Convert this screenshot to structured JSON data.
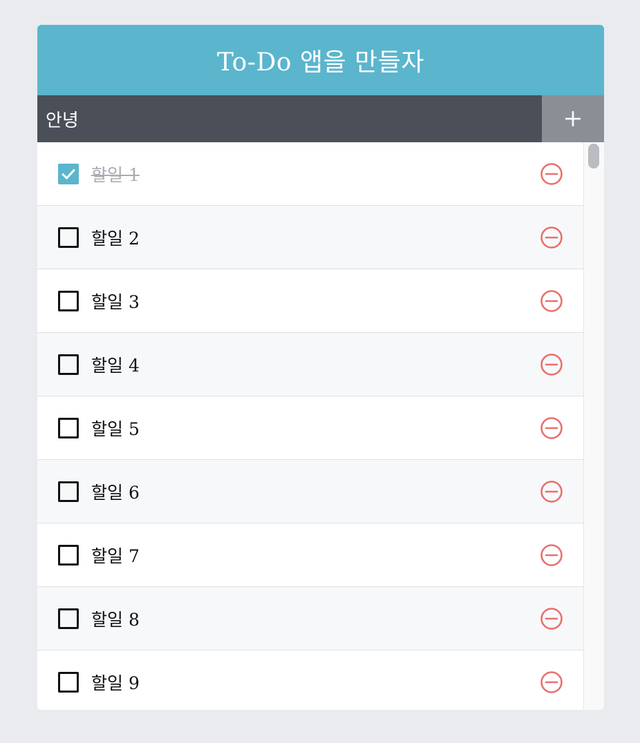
{
  "header": {
    "title": "To-Do 앱을 만들자"
  },
  "input": {
    "value": "안녕",
    "add_icon": "plus-icon"
  },
  "todos": [
    {
      "label": "할일 1",
      "done": true
    },
    {
      "label": "할일 2",
      "done": false
    },
    {
      "label": "할일 3",
      "done": false
    },
    {
      "label": "할일 4",
      "done": false
    },
    {
      "label": "할일 5",
      "done": false
    },
    {
      "label": "할일 6",
      "done": false
    },
    {
      "label": "할일 7",
      "done": false
    },
    {
      "label": "할일 8",
      "done": false
    },
    {
      "label": "할일 9",
      "done": false
    }
  ],
  "colors": {
    "header_bg": "#5bb5cd",
    "input_bg": "#4b4f57",
    "add_button_bg": "#8a8f96",
    "checked": "#5bb5cd",
    "remove": "#e8706d",
    "page_bg": "#e9ebef"
  },
  "icons": {
    "checkbox_checked": "checkbox-checked-icon",
    "checkbox_unchecked": "checkbox-unchecked-icon",
    "remove": "remove-circle-icon"
  }
}
